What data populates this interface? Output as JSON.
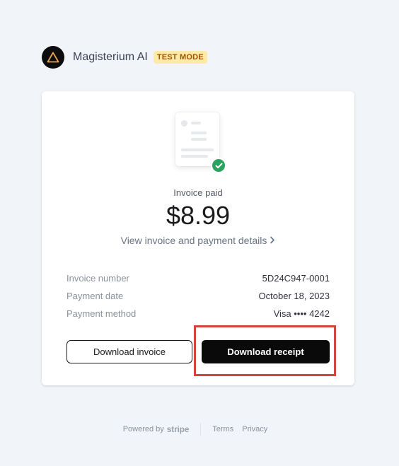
{
  "merchant": {
    "name": "Magisterium AI",
    "mode_badge": "TEST MODE"
  },
  "invoice": {
    "status_label": "Invoice paid",
    "amount": "$8.99",
    "view_details_label": "View invoice and payment details",
    "details": [
      {
        "label": "Invoice number",
        "value": "5D24C947-0001"
      },
      {
        "label": "Payment date",
        "value": "October 18, 2023"
      },
      {
        "label": "Payment method",
        "value": "Visa •••• 4242"
      }
    ]
  },
  "actions": {
    "download_invoice_label": "Download invoice",
    "download_receipt_label": "Download receipt"
  },
  "footer": {
    "powered_by": "Powered by",
    "brand": "stripe",
    "links": [
      "Terms",
      "Privacy"
    ]
  },
  "colors": {
    "background": "#f1f4f8",
    "badge_bg": "#fde9a8",
    "badge_text": "#a35200",
    "success": "#2aa35f",
    "primary_button": "#0a0a0a",
    "highlight_box": "#d0463c"
  },
  "icons": {
    "logo": "triangle-logo-icon",
    "paid": "check-circle-icon",
    "chevron": "chevron-right-icon"
  }
}
